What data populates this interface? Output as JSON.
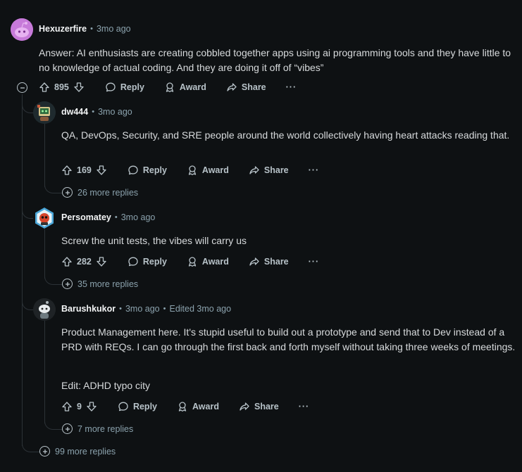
{
  "colors": {
    "background": "#0e1113",
    "text": "#d7dadc",
    "muted": "#8ba2ad",
    "thread": "#2c3237"
  },
  "root": {
    "author": "Hexuzerfire",
    "time": "3mo ago",
    "body": "Answer: AI enthusiasts are creating cobbled together apps using ai programming tools and they have little to no knowledge of actual coding. And they are doing it off of “vibes”",
    "votes": "895",
    "more_replies": "99 more replies"
  },
  "actions": {
    "reply": "Reply",
    "award": "Award",
    "share": "Share",
    "more": "···"
  },
  "replies": [
    {
      "author": "dw444",
      "time": "3mo ago",
      "body": "QA, DevOps, Security, and SRE people around the world collectively having heart attacks reading that.",
      "votes": "169",
      "more_replies": "26 more replies"
    },
    {
      "author": "Persomatey",
      "time": "3mo ago",
      "body": "Screw the unit tests, the vibes will carry us",
      "votes": "282",
      "more_replies": "35 more replies"
    },
    {
      "author": "Barushkukor",
      "time": "3mo ago",
      "edited": "Edited 3mo ago",
      "body": "Product Management here. It's stupid useful to build out a prototype and send that to Dev instead of a PRD with REQs. I can go through the first back and forth myself without taking three weeks of meetings.",
      "body2": "Edit: ADHD typo city",
      "votes": "9",
      "more_replies": "7 more replies"
    }
  ]
}
